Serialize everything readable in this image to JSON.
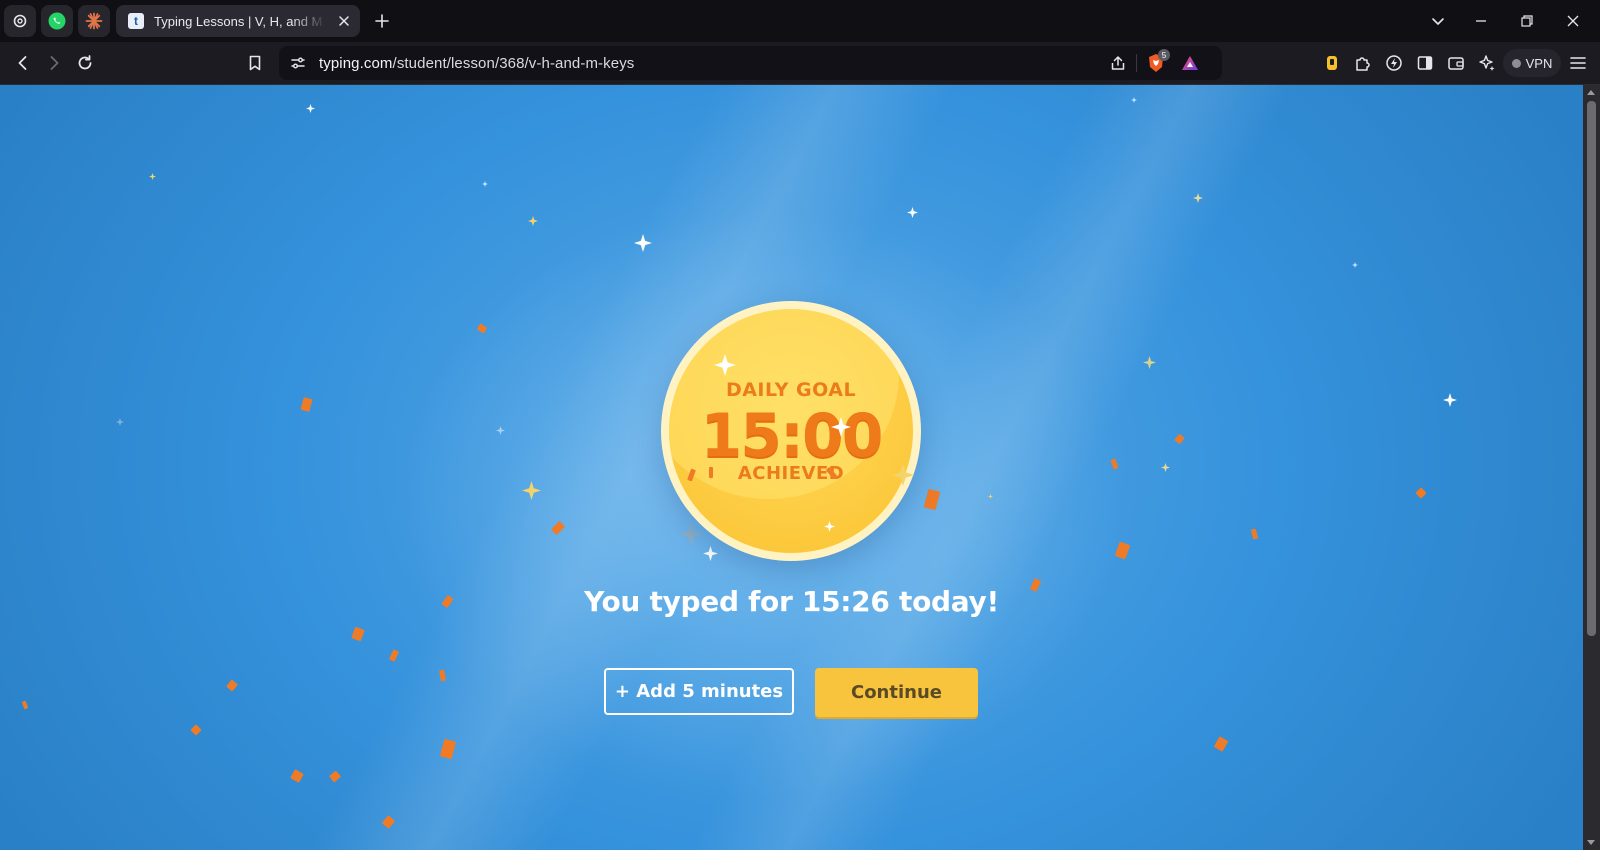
{
  "browser": {
    "pinned_tabs": [
      {
        "name": "chatgpt",
        "icon": "openai-icon"
      },
      {
        "name": "whatsapp",
        "icon": "whatsapp-icon"
      },
      {
        "name": "claude",
        "icon": "claude-icon"
      }
    ],
    "active_tab": {
      "favicon": "t",
      "title": "Typing Lessons | V, H, and M Keys"
    },
    "new_tab_icon": "plus-icon",
    "url": {
      "host": "typing.com",
      "path": "/student/lesson/368/v-h-and-m-keys"
    },
    "brave_shields_count": "5",
    "vpn_label": "VPN"
  },
  "badge": {
    "title": "DAILY GOAL",
    "time": "15:00",
    "subtitle": "ACHIEVED"
  },
  "message": "You typed for 15:26 today!",
  "buttons": {
    "add": "+ Add 5 minutes",
    "continue": "Continue"
  },
  "colors": {
    "background_blue": "#3592dc",
    "badge_yellow": "#fcc83b",
    "badge_text_orange": "#ee7a1a",
    "continue_button": "#f8c43d",
    "confetti": "#f07b27"
  }
}
